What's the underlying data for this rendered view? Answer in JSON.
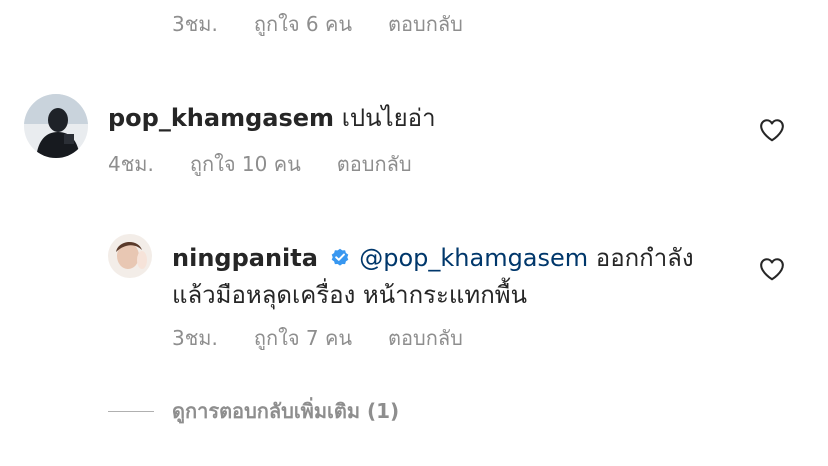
{
  "top_comment_meta": {
    "time": "3ชม.",
    "likes": "ถูกใจ 6 คน",
    "reply": "ตอบกลับ"
  },
  "comment1": {
    "username": "pop_khamgasem",
    "text": "เปนไยอ่า",
    "meta": {
      "time": "4ชม.",
      "likes": "ถูกใจ 10 คน",
      "reply": "ตอบกลับ"
    }
  },
  "reply1": {
    "username": "ningpanita",
    "verified": true,
    "mention": "@pop_khamgasem",
    "text_line1": "ออกกำลัง",
    "text_line2": "แล้วมือหลุดเครื่อง หน้ากระแทกพื้น",
    "meta": {
      "time": "3ชม.",
      "likes": "ถูกใจ 7 คน",
      "reply": "ตอบกลับ"
    }
  },
  "view_more_replies": "ดูการตอบกลับเพิ่มเติม (1)",
  "colors": {
    "secondary_text": "#8e8e8e",
    "mention": "#00376b",
    "verified": "#3897f0"
  },
  "icons": {
    "like": "heart-outline-icon",
    "verified": "verified-badge-icon"
  }
}
